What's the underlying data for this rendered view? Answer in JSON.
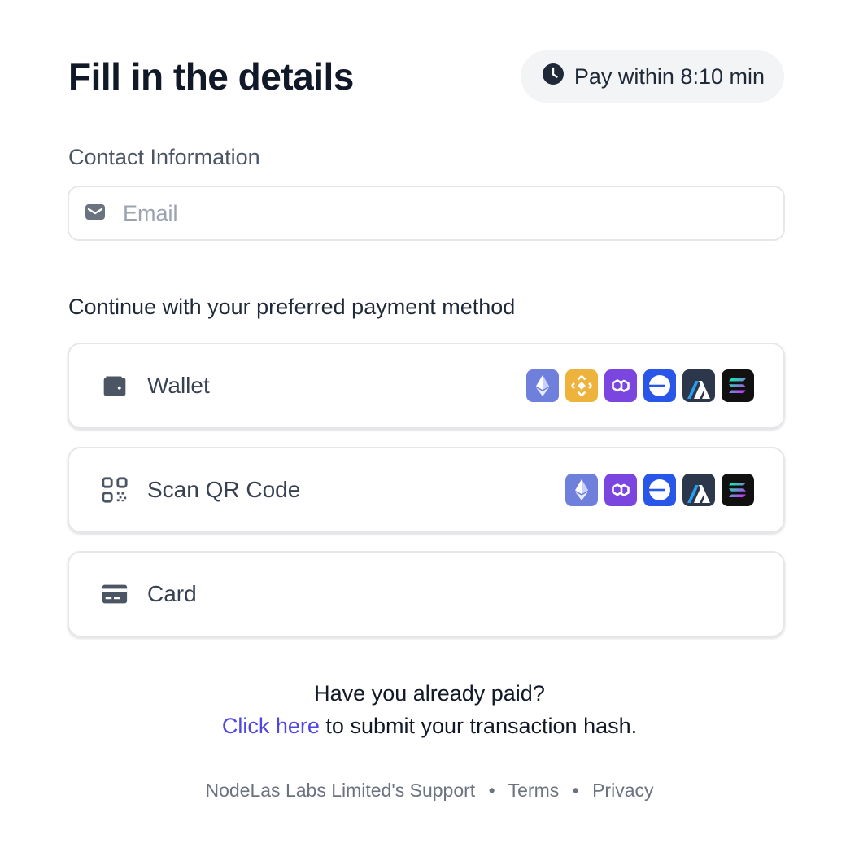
{
  "header": {
    "title": "Fill in the details",
    "timer_text": "Pay within 8:10 min"
  },
  "contact": {
    "label": "Contact Information",
    "email_placeholder": "Email",
    "email_value": ""
  },
  "payment": {
    "label": "Continue with your preferred payment method",
    "methods": [
      {
        "label": "Wallet",
        "icon": "wallet-icon",
        "coins": [
          "ethereum",
          "bnb",
          "polygon",
          "base",
          "arbitrum",
          "solana"
        ]
      },
      {
        "label": "Scan QR Code",
        "icon": "qr-code-icon",
        "coins": [
          "ethereum",
          "polygon",
          "base",
          "arbitrum",
          "solana"
        ]
      },
      {
        "label": "Card",
        "icon": "credit-card-icon",
        "coins": []
      }
    ]
  },
  "paid": {
    "question": "Have you already paid?",
    "link_text": "Click here",
    "suffix": " to submit your transaction hash."
  },
  "footer": {
    "support": "NodeLas Labs Limited's Support",
    "terms": "Terms",
    "privacy": "Privacy",
    "separator": "•"
  },
  "colors": {
    "accent_link": "#4f46e5",
    "ethereum": "#6f7fdc",
    "bnb": "#eeb33c",
    "polygon": "#7b46e0",
    "base": "#2756e8",
    "arbitrum": "#2d374b",
    "solana": "#111111"
  }
}
